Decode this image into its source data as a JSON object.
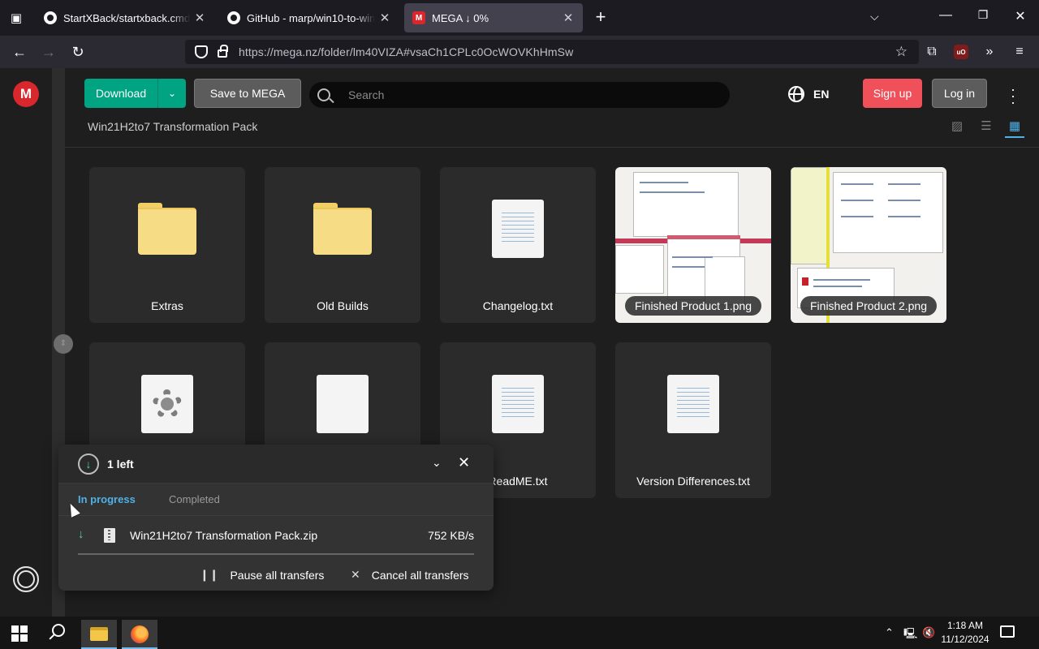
{
  "browser": {
    "tabs": [
      {
        "title": "StartXBack/startxback.cmd at n",
        "favicon": "github-icon",
        "active": false
      },
      {
        "title": "GitHub - marp/win10-to-win7-",
        "favicon": "github-icon",
        "active": false
      },
      {
        "title": "MEGA ↓ 0%",
        "favicon": "mega-icon",
        "active": true
      }
    ],
    "url": "https://mega.nz/folder/lm40VIZA#vsaCh1CPLc0OcWOVKhHmSw"
  },
  "mega": {
    "logo_letter": "M",
    "download_label": "Download",
    "save_label": "Save to MEGA",
    "search_placeholder": "Search",
    "language": "EN",
    "signup_label": "Sign up",
    "login_label": "Log in",
    "breadcrumb": "Win21H2to7 Transformation Pack"
  },
  "files": [
    {
      "name": "Extras",
      "kind": "folder"
    },
    {
      "name": "Old Builds",
      "kind": "folder"
    },
    {
      "name": "Changelog.txt",
      "kind": "text"
    },
    {
      "name": "Finished Product 1.png",
      "kind": "image"
    },
    {
      "name": "Finished Product 2.png",
      "kind": "image"
    },
    {
      "name": "",
      "kind": "settings"
    },
    {
      "name": "",
      "kind": "generic"
    },
    {
      "name": "ReadME.txt",
      "kind": "text"
    },
    {
      "name": "Version Differences.txt",
      "kind": "text"
    }
  ],
  "transfers": {
    "count_label": "1 left",
    "tab_in_progress": "In progress",
    "tab_completed": "Completed",
    "item": {
      "filename": "Win21H2to7 Transformation Pack.zip",
      "speed": "752 KB/s"
    },
    "pause_label": "Pause all transfers",
    "cancel_label": "Cancel all transfers"
  },
  "taskbar": {
    "time": "1:18 AM",
    "date": "11/12/2024"
  }
}
